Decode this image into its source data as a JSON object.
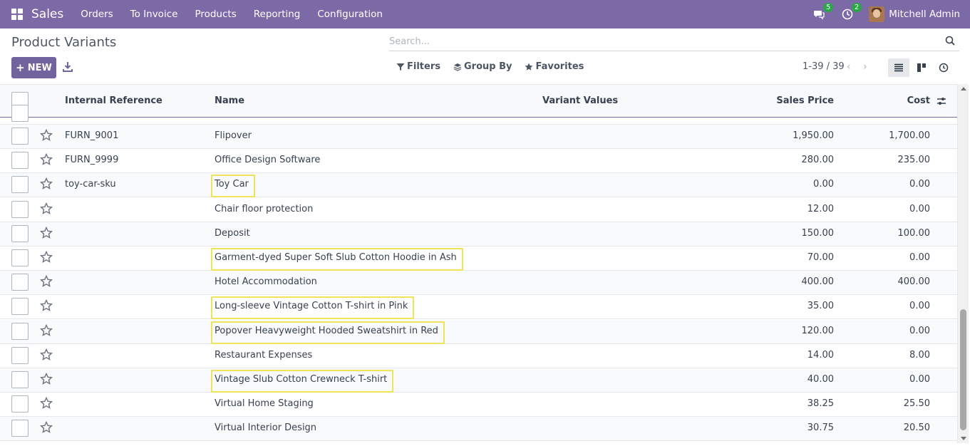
{
  "navbar": {
    "brand": "Sales",
    "menu": [
      "Orders",
      "To Invoice",
      "Products",
      "Reporting",
      "Configuration"
    ],
    "messages_badge": "5",
    "activities_badge": "2",
    "user_name": "Mitchell Admin"
  },
  "control_panel": {
    "title": "Product Variants",
    "search_placeholder": "Search...",
    "new_label": "NEW",
    "filters_label": "Filters",
    "group_by_label": "Group By",
    "favorites_label": "Favorites",
    "pager": "1-39 / 39",
    "prev_symbol": "‹",
    "next_symbol": "›"
  },
  "table": {
    "columns": {
      "internal_reference": "Internal Reference",
      "name": "Name",
      "variant_values": "Variant Values",
      "sales_price": "Sales Price",
      "cost": "Cost"
    },
    "rows": [
      {
        "ref": "FURN_9001",
        "name": "Flipover",
        "price": "1,950.00",
        "cost": "1,700.00",
        "highlighted": false
      },
      {
        "ref": "FURN_9999",
        "name": "Office Design Software",
        "price": "280.00",
        "cost": "235.00",
        "highlighted": false
      },
      {
        "ref": "toy-car-sku",
        "name": "Toy Car",
        "price": "0.00",
        "cost": "0.00",
        "highlighted": true
      },
      {
        "ref": "",
        "name": "Chair floor protection",
        "price": "12.00",
        "cost": "0.00",
        "highlighted": false
      },
      {
        "ref": "",
        "name": "Deposit",
        "price": "150.00",
        "cost": "100.00",
        "highlighted": false
      },
      {
        "ref": "",
        "name": "Garment-dyed Super Soft Slub Cotton Hoodie in Ash",
        "price": "70.00",
        "cost": "0.00",
        "highlighted": true
      },
      {
        "ref": "",
        "name": "Hotel Accommodation",
        "price": "400.00",
        "cost": "400.00",
        "highlighted": false
      },
      {
        "ref": "",
        "name": "Long-sleeve Vintage Cotton T-shirt in Pink",
        "price": "35.00",
        "cost": "0.00",
        "highlighted": true
      },
      {
        "ref": "",
        "name": "Popover Heavyweight Hooded Sweatshirt in Red",
        "price": "120.00",
        "cost": "0.00",
        "highlighted": true
      },
      {
        "ref": "",
        "name": "Restaurant Expenses",
        "price": "14.00",
        "cost": "8.00",
        "highlighted": false
      },
      {
        "ref": "",
        "name": "Vintage Slub Cotton Crewneck T-shirt",
        "price": "40.00",
        "cost": "0.00",
        "highlighted": true
      },
      {
        "ref": "",
        "name": "Virtual Home Staging",
        "price": "38.25",
        "cost": "25.50",
        "highlighted": false
      },
      {
        "ref": "",
        "name": "Virtual Interior Design",
        "price": "30.75",
        "cost": "20.50",
        "highlighted": false
      }
    ]
  },
  "colors": {
    "navbar": "#7c6aa6",
    "primary_button": "#71639e",
    "highlight_border": "#f0e35c",
    "badge": "#28a745"
  }
}
